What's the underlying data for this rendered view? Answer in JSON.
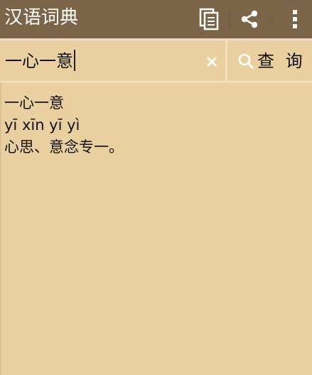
{
  "app": {
    "title": "汉语词典",
    "colors": {
      "appbar_bg": "#7b6448",
      "page_bg": "#ead0a0"
    }
  },
  "toolbar": {
    "copy_icon": "copy-icon",
    "share_icon": "share-icon",
    "more_icon": "more-vertical-icon"
  },
  "search": {
    "value": "一心一意",
    "clear_icon": "close-icon",
    "query_icon": "search-icon",
    "query_label": "查 询"
  },
  "result": {
    "word": "一心一意",
    "pinyin": "yī xīn yī yì",
    "definition": "心思、意念专一。"
  }
}
